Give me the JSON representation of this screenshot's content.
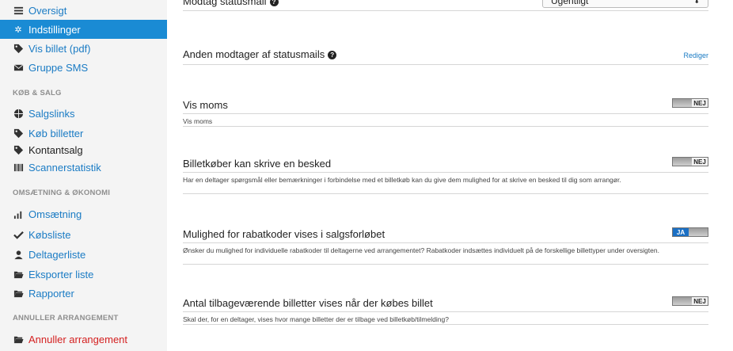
{
  "sidebar": {
    "items": [
      {
        "label": "Oversigt",
        "icon": "list-icon"
      },
      {
        "label": "Indstillinger",
        "icon": "gear-icon",
        "active": true
      },
      {
        "label": "Vis billet (pdf)",
        "icon": "tag-icon"
      },
      {
        "label": "Gruppe SMS",
        "icon": "envelope-icon"
      },
      {
        "label": "Salgslinks",
        "icon": "globe-icon"
      },
      {
        "label": "Køb billetter",
        "icon": "tag-icon"
      },
      {
        "label": "Kontantsalg",
        "icon": "tag-icon"
      },
      {
        "label": "Scannerstatistik",
        "icon": "barcode-icon"
      },
      {
        "label": "Omsætning",
        "icon": "bar-chart-icon"
      },
      {
        "label": "Købsliste",
        "icon": "check-icon"
      },
      {
        "label": "Deltagerliste",
        "icon": "user-icon"
      },
      {
        "label": "Eksporter liste",
        "icon": "folder-open-icon"
      },
      {
        "label": "Rapporter",
        "icon": "folder-open-icon"
      },
      {
        "label": "Annuller arrangement",
        "icon": "folder-open-icon"
      }
    ],
    "sections": [
      "KØB & SALG",
      "OMSÆTNING & ØKONOMI",
      "ANNULLER ARRANGEMENT"
    ]
  },
  "settings": {
    "status_mail": {
      "label": "Modtag statusmail",
      "value": "Ugentligt"
    },
    "other_recipient": {
      "label": "Anden modtager af statusmails",
      "action": "Rediger"
    },
    "vat": {
      "label": "Vis moms",
      "desc": "Vis moms",
      "toggle": "NEJ"
    },
    "message": {
      "label": "Billetkøber kan skrive en besked",
      "desc": "Har en deltager spørgsmål eller bemærkninger i forbindelse med et billetkøb kan du give dem mulighed for at skrive en besked til dig som arrangør.",
      "toggle": "NEJ"
    },
    "discount": {
      "label": "Mulighed for rabatkoder vises i salgsforløbet",
      "desc": "Ønsker du mulighed for individuelle rabatkoder til deltagerne ved arrangementet? Rabatkoder indsættes individuelt på de forskellige billettyper under oversigten.",
      "toggle": "JA"
    },
    "remaining": {
      "label": "Antal tilbageværende billetter vises når der købes billet",
      "desc": "Skal der, for en deltager, vises hvor mange billetter der er tilbage ved billetkøb/tilmelding?",
      "toggle": "NEJ"
    }
  }
}
